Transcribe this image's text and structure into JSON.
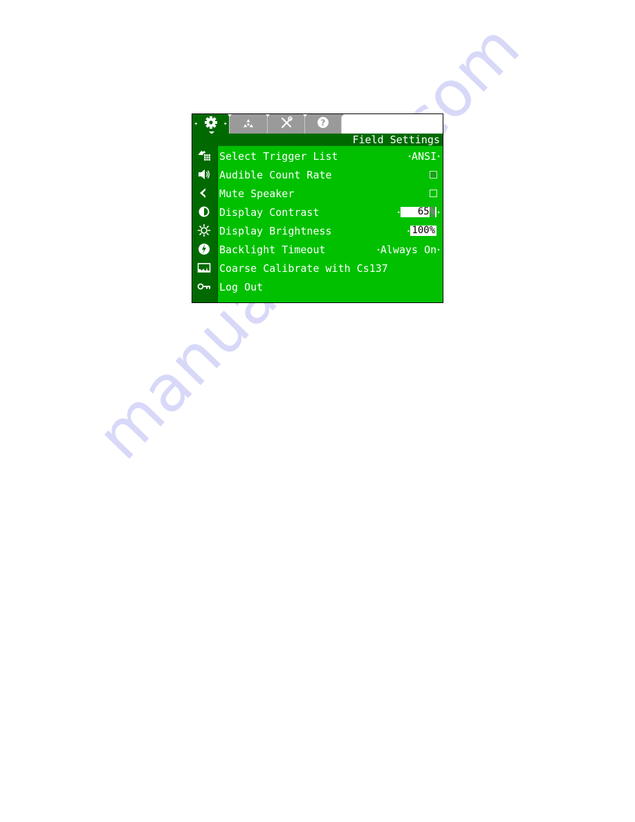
{
  "watermark": "manualshive.com",
  "colors": {
    "screen_bg": "#00c000",
    "dark_green": "#006a00",
    "tab_inactive": "#9a9a9a",
    "text": "#ffffff"
  },
  "tabs": [
    {
      "name": "settings",
      "icon": "gear-icon",
      "active": true,
      "left_arrow": "◂",
      "right_arrow": "▸"
    },
    {
      "name": "radiation",
      "icon": "radiation-icon",
      "active": false
    },
    {
      "name": "tools",
      "icon": "tools-icon",
      "active": false
    },
    {
      "name": "help",
      "icon": "help-icon",
      "active": false
    }
  ],
  "title": "Field Settings",
  "items": [
    {
      "label": "Select Trigger List",
      "icon": "trigger-list-icon",
      "type": "selector",
      "value": "ANSI",
      "left": "◂",
      "right": "▸"
    },
    {
      "label": "Audible Count Rate",
      "icon": "speaker-icon",
      "type": "checkbox",
      "checked": true
    },
    {
      "label": "Mute Speaker",
      "icon": "mute-icon",
      "type": "checkbox",
      "checked": false
    },
    {
      "label": "Display Contrast",
      "icon": "contrast-icon",
      "type": "spin",
      "value": "65",
      "unit": "%",
      "left": "◂",
      "right": "▸"
    },
    {
      "label": "Display Brightness",
      "icon": "brightness-icon",
      "type": "spin",
      "value": "100%",
      "left": "◂"
    },
    {
      "label": "Backlight Timeout",
      "icon": "backlight-icon",
      "type": "selector",
      "value": "Always On",
      "left": "◂",
      "right": "▸"
    },
    {
      "label": "Coarse Calibrate with Cs137",
      "icon": "calibrate-icon",
      "type": "action"
    },
    {
      "label": "Log Out",
      "icon": "key-icon",
      "type": "action"
    }
  ]
}
